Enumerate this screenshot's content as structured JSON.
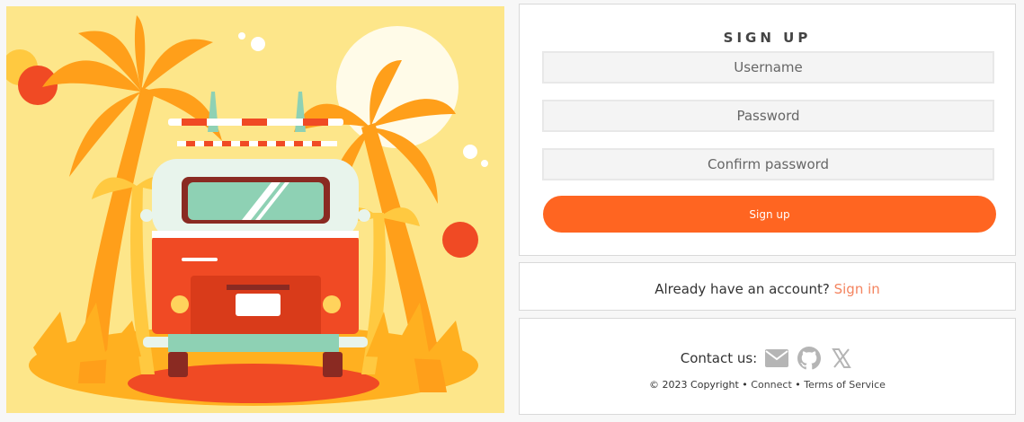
{
  "hero": {
    "image": "van-under-palm-trees-illustration"
  },
  "signup": {
    "title": "SIGN UP",
    "username_placeholder": "Username",
    "password_placeholder": "Password",
    "confirm_placeholder": "Confirm password",
    "submit_label": "Sign up"
  },
  "signin": {
    "prompt": "Already have an account?",
    "link_label": "Sign in"
  },
  "footer": {
    "contact_label": "Contact us:",
    "icons": [
      "mail-icon",
      "github-icon",
      "x-icon"
    ],
    "copyright": "© 2023 Copyright",
    "brand": "Connect",
    "terms_label": "Terms of Service",
    "separator": "•"
  },
  "colors": {
    "accent": "#ff6521",
    "link": "#f4845f",
    "hero_bg": "#fde68a",
    "van_red": "#f04a24",
    "palm_orange": "#ff9f1a"
  }
}
